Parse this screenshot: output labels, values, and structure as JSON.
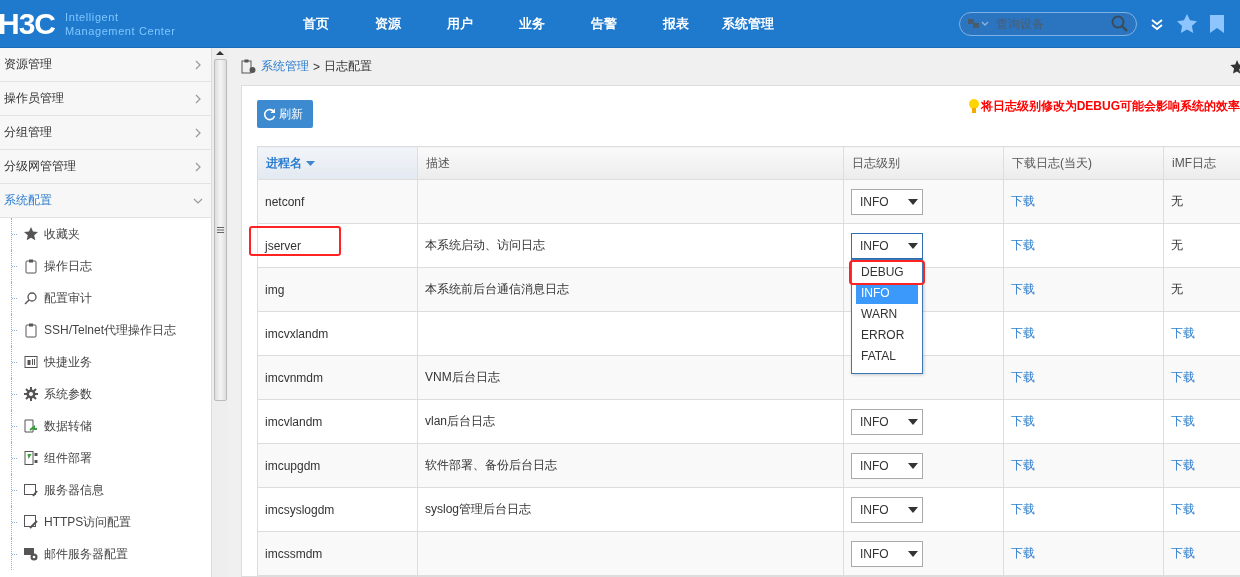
{
  "header": {
    "logo": "H3C",
    "tagline": [
      "Intelligent",
      "Management Center"
    ],
    "nav": [
      {
        "label": "首页"
      },
      {
        "label": "资源"
      },
      {
        "label": "用户"
      },
      {
        "label": "业务"
      },
      {
        "label": "告警"
      },
      {
        "label": "报表"
      },
      {
        "label": "系统管理"
      }
    ],
    "search": {
      "placeholder": "查询设备"
    }
  },
  "sidebar": {
    "items": [
      {
        "label": "资源管理",
        "expanded": false
      },
      {
        "label": "操作员管理",
        "expanded": false
      },
      {
        "label": "分组管理",
        "expanded": false
      },
      {
        "label": "分级网管管理",
        "expanded": false
      },
      {
        "label": "系统配置",
        "expanded": true,
        "children": [
          {
            "label": "收藏夹",
            "kind": "star"
          },
          {
            "label": "操作日志",
            "kind": "clipboard"
          },
          {
            "label": "配置审计",
            "kind": "audit"
          },
          {
            "label": "SSH/Telnet代理操作日志",
            "kind": "clipboard"
          },
          {
            "label": "快捷业务",
            "kind": "card"
          },
          {
            "label": "系统参数",
            "kind": "gear"
          },
          {
            "label": "数据转储",
            "kind": "export"
          },
          {
            "label": "组件部署",
            "kind": "deploy"
          },
          {
            "label": "服务器信息",
            "kind": "server"
          },
          {
            "label": "HTTPS访问配置",
            "kind": "https"
          },
          {
            "label": "邮件服务器配置",
            "kind": "mail"
          }
        ]
      }
    ]
  },
  "breadcrumb": {
    "parent": "系统管理",
    "separator": ">",
    "current": "日志配置"
  },
  "toolbar": {
    "refresh": "刷新",
    "hint": "将日志级别修改为DEBUG可能会影响系统的效率"
  },
  "table": {
    "columns": [
      {
        "label": "进程名",
        "sorted": true
      },
      {
        "label": "描述",
        "sorted": false
      },
      {
        "label": "日志级别",
        "sorted": false
      },
      {
        "label": "下载日志(当天)",
        "sorted": false
      },
      {
        "label": "iMF日志",
        "sorted": false
      }
    ],
    "rows": [
      {
        "name": "netconf",
        "level": "INFO",
        "download": "下载",
        "imf": {
          "text": "无",
          "link": false
        },
        "highlighted": false
      },
      {
        "name": "jserver",
        "description": "本系统启动、访问日志",
        "level": "INFO",
        "download": "下载",
        "imf": {
          "text": "无",
          "link": false
        },
        "highlighted": true,
        "dropdown": {
          "options": [
            {
              "label": "DEBUG",
              "selected": false,
              "highlighted": true
            },
            {
              "label": "INFO",
              "selected": true,
              "highlighted": false
            },
            {
              "label": "WARN",
              "selected": false,
              "highlighted": false
            },
            {
              "label": "ERROR",
              "selected": false,
              "highlighted": false
            },
            {
              "label": "FATAL",
              "selected": false,
              "highlighted": false
            }
          ]
        }
      },
      {
        "name": "img",
        "description": "本系统前后台通信消息日志",
        "download": "下载",
        "imf": {
          "text": "无",
          "link": false
        },
        "highlighted": false
      },
      {
        "name": "imcvxlandm",
        "download": "下载",
        "imf": {
          "text": "下载",
          "link": true
        },
        "highlighted": false
      },
      {
        "name": "imcvnmdm",
        "description": "VNM后台日志",
        "download": "下载",
        "imf": {
          "text": "下载",
          "link": true
        },
        "highlighted": false
      },
      {
        "name": "imcvlandm",
        "description": "vlan后台日志",
        "level": "INFO",
        "download": "下载",
        "imf": {
          "text": "下载",
          "link": true
        },
        "highlighted": false
      },
      {
        "name": "imcupgdm",
        "description": "软件部署、备份后台日志",
        "level": "INFO",
        "download": "下载",
        "imf": {
          "text": "下载",
          "link": true
        },
        "highlighted": false
      },
      {
        "name": "imcsyslogdm",
        "description": "syslog管理后台日志",
        "level": "INFO",
        "download": "下载",
        "imf": {
          "text": "下载",
          "link": true
        },
        "highlighted": false
      },
      {
        "name": "imcssmdm",
        "level": "INFO",
        "download": "下载",
        "imf": {
          "text": "下载",
          "link": true
        },
        "highlighted": false
      }
    ]
  }
}
